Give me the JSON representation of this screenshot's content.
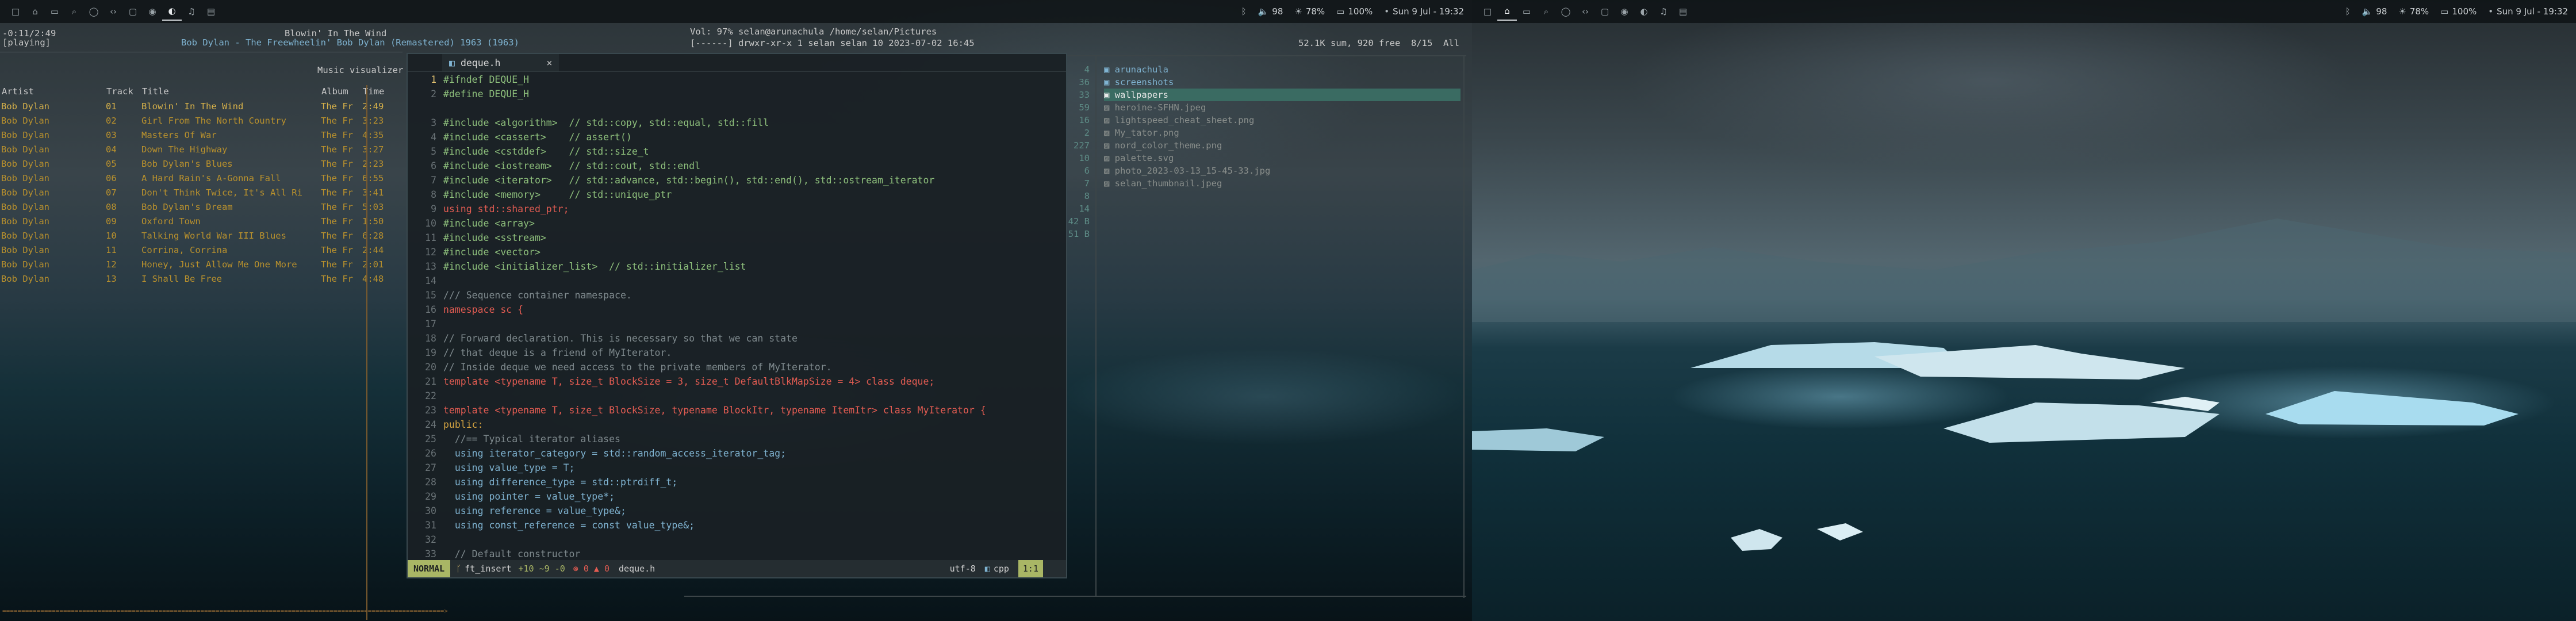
{
  "left_monitor": {
    "workspaces": [
      "1",
      "2",
      "3",
      "4",
      "5",
      "6",
      "7",
      "8",
      "9",
      "10",
      "11"
    ],
    "active_workspace": "9",
    "status": {
      "volume": "98",
      "brightness": "78%",
      "battery": "100%",
      "datetime": "Sun 9 Jul - 19:32"
    }
  },
  "right_monitor": {
    "workspaces": [
      "1",
      "2",
      "3",
      "4",
      "5",
      "6",
      "7",
      "8",
      "9",
      "10",
      "11"
    ],
    "active_workspace": "2",
    "status": {
      "volume": "98",
      "brightness": "78%",
      "battery": "100%",
      "datetime": "Sun 9 Jul - 19:32"
    }
  },
  "music": {
    "time_line": "-0:11/2:49",
    "state": "[playing]",
    "now_playing_title": "Blowin' In The Wind",
    "now_playing_artist_line": "Bob Dylan - The Freewheelin' Bob Dylan (Remastered) 1963 (1963)",
    "visualizer_label": "Music visualizer",
    "columns": [
      "Artist",
      "Track",
      "Title",
      "Album",
      "Time"
    ],
    "tracks": [
      {
        "artist": "Bob Dylan",
        "track": "01",
        "title": "Blowin' In The Wind",
        "album": "The Fr",
        "time": "2:49"
      },
      {
        "artist": "Bob Dylan",
        "track": "02",
        "title": "Girl From The North Country",
        "album": "The Fr",
        "time": "3:23"
      },
      {
        "artist": "Bob Dylan",
        "track": "03",
        "title": "Masters Of War",
        "album": "The Fr",
        "time": "4:35"
      },
      {
        "artist": "Bob Dylan",
        "track": "04",
        "title": "Down The Highway",
        "album": "The Fr",
        "time": "3:27"
      },
      {
        "artist": "Bob Dylan",
        "track": "05",
        "title": "Bob Dylan's Blues",
        "album": "The Fr",
        "time": "2:23"
      },
      {
        "artist": "Bob Dylan",
        "track": "06",
        "title": "A Hard Rain's A-Gonna Fall",
        "album": "The Fr",
        "time": "6:55"
      },
      {
        "artist": "Bob Dylan",
        "track": "07",
        "title": "Don't Think Twice, It's All Ri",
        "album": "The Fr",
        "time": "3:41"
      },
      {
        "artist": "Bob Dylan",
        "track": "08",
        "title": "Bob Dylan's Dream",
        "album": "The Fr",
        "time": "5:03"
      },
      {
        "artist": "Bob Dylan",
        "track": "09",
        "title": "Oxford Town",
        "album": "The Fr",
        "time": "1:50"
      },
      {
        "artist": "Bob Dylan",
        "track": "10",
        "title": "Talking World War III Blues",
        "album": "The Fr",
        "time": "6:28"
      },
      {
        "artist": "Bob Dylan",
        "track": "11",
        "title": "Corrina, Corrina",
        "album": "The Fr",
        "time": "2:44"
      },
      {
        "artist": "Bob Dylan",
        "track": "12",
        "title": "Honey, Just Allow Me One More",
        "album": "The Fr",
        "time": "2:01"
      },
      {
        "artist": "Bob Dylan",
        "track": "13",
        "title": "I Shall Be Free",
        "album": "The Fr",
        "time": "4:48"
      }
    ],
    "progress": 0.93
  },
  "ranger": {
    "vol_line": "Vol: 97% selan@arunachula /home/selan/Pictures",
    "perm_line": "[------] drwxr-xr-x 1 selan selan 10 2023-07-02 16:45",
    "disk_line": "52.1K sum, 920 free  8/15  All",
    "counts": [
      "4",
      "36",
      "33",
      "59",
      "16",
      "2",
      "227",
      "10",
      "6",
      "7",
      "8",
      "14",
      "42 B",
      "51 B"
    ],
    "entries": [
      {
        "name": "arunachula",
        "type": "dir"
      },
      {
        "name": "screenshots",
        "type": "dir"
      },
      {
        "name": "wallpapers",
        "type": "dir",
        "selected": true
      },
      {
        "name": "heroine-SFHN.jpeg",
        "type": "file"
      },
      {
        "name": "lightspeed_cheat_sheet.png",
        "type": "file"
      },
      {
        "name": "My_tator.png",
        "type": "file"
      },
      {
        "name": "nord_color_theme.png",
        "type": "file"
      },
      {
        "name": "palette.svg",
        "type": "file"
      },
      {
        "name": "photo_2023-03-13_15-45-33.jpg",
        "type": "file"
      },
      {
        "name": "selan_thumbnail.jpeg",
        "type": "file"
      }
    ]
  },
  "editor": {
    "tab_name": "deque.h",
    "close": "×",
    "mode": "NORMAL",
    "branch": "ft_insert",
    "diff": "+10 ~9 -0",
    "diagnostics": "0 ▲ 0",
    "filename": "deque.h",
    "encoding": "utf-8",
    "filetype": "cpp",
    "position": "1:1",
    "lines": [
      {
        "n": "1",
        "t": "#ifndef DEQUE_H",
        "c": "pp"
      },
      {
        "n": "2",
        "t": "#define DEQUE_H",
        "c": "pp"
      },
      {
        "n": "",
        "t": "",
        "c": "pl"
      },
      {
        "n": "3",
        "t": "#include <algorithm>  // std::copy, std::equal, std::fill",
        "c": "pp"
      },
      {
        "n": "4",
        "t": "#include <cassert>    // assert()",
        "c": "pp"
      },
      {
        "n": "5",
        "t": "#include <cstddef>    // std::size_t",
        "c": "pp"
      },
      {
        "n": "6",
        "t": "#include <iostream>   // std::cout, std::endl",
        "c": "pp"
      },
      {
        "n": "7",
        "t": "#include <iterator>   // std::advance, std::begin(), std::end(), std::ostream_iterator",
        "c": "pp"
      },
      {
        "n": "8",
        "t": "#include <memory>     // std::unique_ptr",
        "c": "pp"
      },
      {
        "n": "9",
        "t": "using std::shared_ptr;",
        "c": "kw"
      },
      {
        "n": "10",
        "t": "#include <array>",
        "c": "pp"
      },
      {
        "n": "11",
        "t": "#include <sstream>",
        "c": "pp"
      },
      {
        "n": "12",
        "t": "#include <vector>",
        "c": "pp"
      },
      {
        "n": "13",
        "t": "#include <initializer_list>  // std::initializer_list",
        "c": "pp"
      },
      {
        "n": "14",
        "t": "",
        "c": "pl"
      },
      {
        "n": "15",
        "t": "/// Sequence container namespace.",
        "c": "com"
      },
      {
        "n": "16",
        "t": "namespace sc {",
        "c": "kw"
      },
      {
        "n": "17",
        "t": "",
        "c": "pl"
      },
      {
        "n": "18",
        "t": "// Forward declaration. This is necessary so that we can state",
        "c": "com"
      },
      {
        "n": "19",
        "t": "// that deque is a friend of MyIterator.",
        "c": "com"
      },
      {
        "n": "20",
        "t": "// Inside deque we need access to the private members of MyIterator.",
        "c": "com"
      },
      {
        "n": "21",
        "t": "template <typename T, size_t BlockSize = 3, size_t DefaultBlkMapSize = 4> class deque;",
        "c": "kw"
      },
      {
        "n": "22",
        "t": "",
        "c": "pl"
      },
      {
        "n": "23",
        "t": "template <typename T, size_t BlockSize, typename BlockItr, typename ItemItr> class MyIterator {",
        "c": "kw"
      },
      {
        "n": "24",
        "t": "public:",
        "c": "fn"
      },
      {
        "n": "25",
        "t": "  //== Typical iterator aliases",
        "c": "com"
      },
      {
        "n": "26",
        "t": "  using iterator_category = std::random_access_iterator_tag;",
        "c": "ty"
      },
      {
        "n": "27",
        "t": "  using value_type = T;",
        "c": "ty"
      },
      {
        "n": "28",
        "t": "  using difference_type = std::ptrdiff_t;",
        "c": "ty"
      },
      {
        "n": "29",
        "t": "  using pointer = value_type*;",
        "c": "ty"
      },
      {
        "n": "30",
        "t": "  using reference = value_type&;",
        "c": "ty"
      },
      {
        "n": "31",
        "t": "  using const_reference = const value_type&;",
        "c": "ty"
      },
      {
        "n": "32",
        "t": "",
        "c": "pl"
      },
      {
        "n": "33",
        "t": "  // Default constructor",
        "c": "com"
      }
    ]
  }
}
